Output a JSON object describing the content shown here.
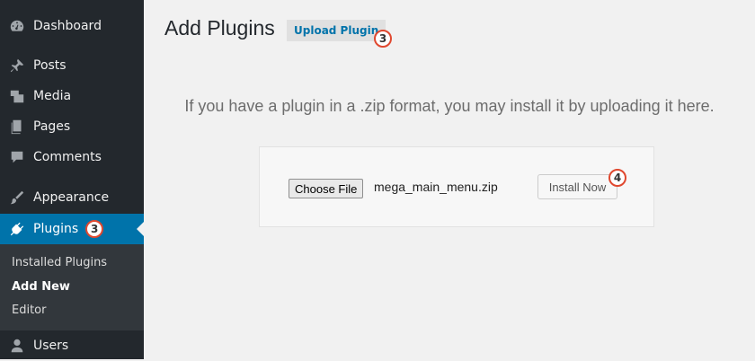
{
  "sidebar": {
    "items": [
      {
        "label": "Dashboard",
        "icon": "dashboard-icon"
      },
      {
        "label": "Posts",
        "icon": "pin-icon"
      },
      {
        "label": "Media",
        "icon": "media-icon"
      },
      {
        "label": "Pages",
        "icon": "pages-icon"
      },
      {
        "label": "Comments",
        "icon": "comment-icon"
      },
      {
        "label": "Appearance",
        "icon": "brush-icon"
      },
      {
        "label": "Plugins",
        "icon": "plug-icon",
        "badge": "3"
      },
      {
        "label": "Users",
        "icon": "user-icon"
      }
    ],
    "submenu": [
      "Installed Plugins",
      "Add New",
      "Editor"
    ]
  },
  "main": {
    "title": "Add Plugins",
    "upload_button": "Upload Plugin",
    "upload_badge": "3",
    "help_text": "If you have a plugin in a .zip format, you may install it by uploading it here.",
    "choose_file_label": "Choose File",
    "file_name": "mega_main_menu.zip",
    "install_button": "Install Now",
    "install_badge": "4"
  },
  "colors": {
    "sidebar_bg": "#23282d",
    "active_bg": "#0073aa",
    "badge_border": "#e0482f"
  }
}
